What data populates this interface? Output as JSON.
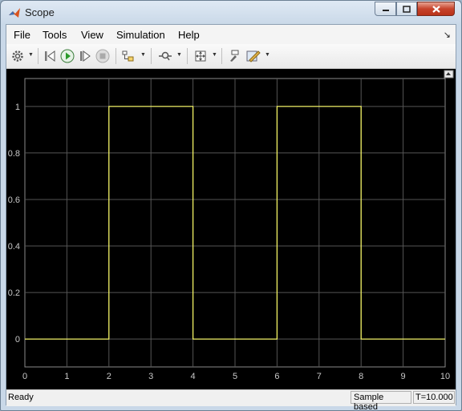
{
  "window": {
    "title": "Scope"
  },
  "menu": [
    {
      "label": "File",
      "key": "file"
    },
    {
      "label": "Tools",
      "key": "tools"
    },
    {
      "label": "View",
      "key": "view"
    },
    {
      "label": "Simulation",
      "key": "simulation"
    },
    {
      "label": "Help",
      "key": "help"
    }
  ],
  "toolbar": {
    "icons": [
      "gear-icon",
      "step-back-icon",
      "run-icon",
      "step-forward-icon",
      "stop-icon",
      "signal-selector-icon",
      "zoom-icon",
      "autoscale-icon",
      "highlight-block-icon",
      "style-icon"
    ]
  },
  "colors": {
    "plot_background": "#000000",
    "signal": "#ffff66",
    "grid": "#555555",
    "tick_label": "#c8c8c8"
  },
  "chart_data": {
    "type": "line",
    "xlim": [
      0,
      10
    ],
    "ylim": [
      -0.12,
      1.12
    ],
    "xticks": [
      0,
      1,
      2,
      3,
      4,
      5,
      6,
      7,
      8,
      9,
      10
    ],
    "yticks": [
      0,
      0.2,
      0.4,
      0.6,
      0.8,
      1
    ],
    "grid": true,
    "series": [
      {
        "x": [
          0,
          2,
          2,
          4,
          4,
          6,
          6,
          8,
          8,
          10
        ],
        "y": [
          0,
          0,
          1,
          1,
          0,
          0,
          1,
          1,
          0,
          0
        ]
      }
    ]
  },
  "statusbar": {
    "text": "Ready",
    "mode": "Sample based",
    "time": "T=10.000"
  }
}
